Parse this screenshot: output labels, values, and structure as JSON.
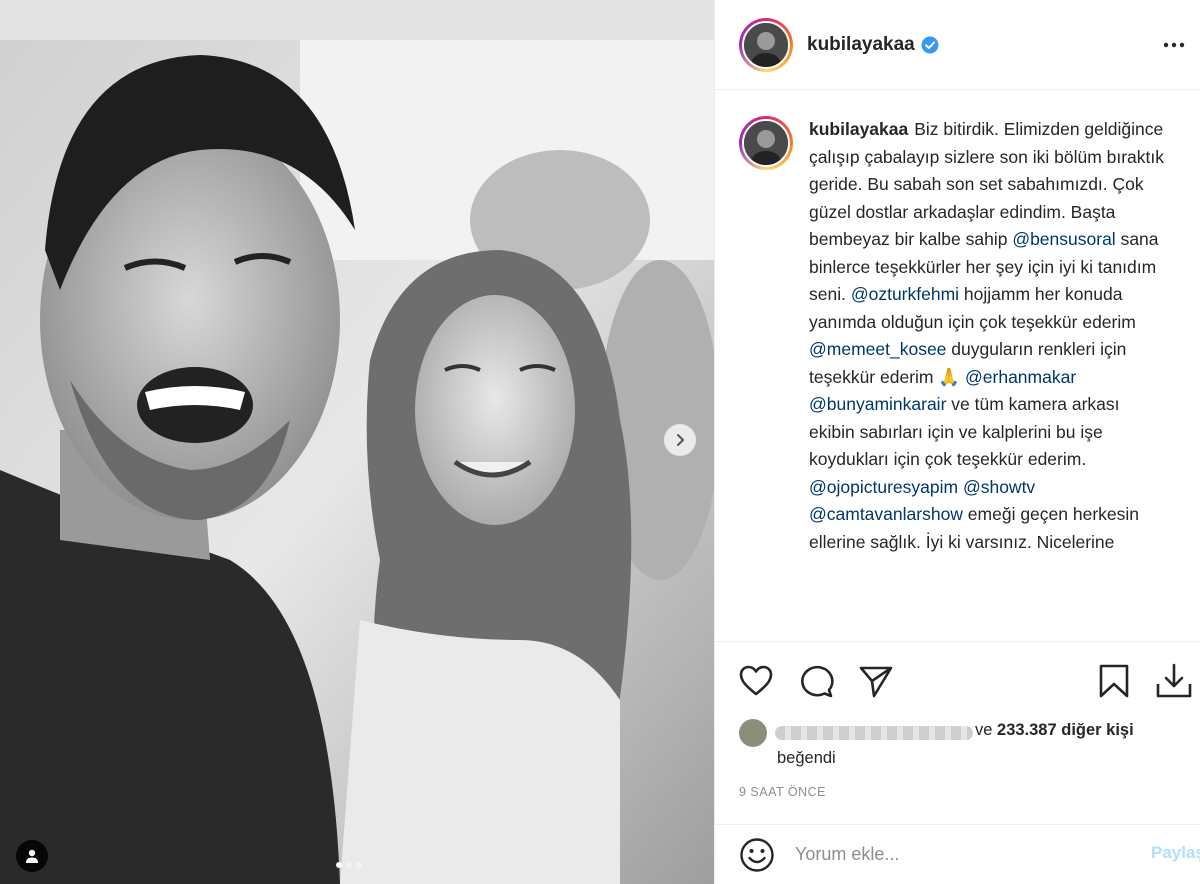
{
  "header": {
    "username": "kubilayakaa",
    "verified": true
  },
  "caption": {
    "username": "kubilayakaa",
    "segments": [
      {
        "text": "Biz bitirdik. Elimizden geldiğince çalışıp çabalayıp sizlere son iki bölüm bıraktık geride. Bu sabah son set sabahımızdı. Çok güzel dostlar arkadaşlar edindim. Başta bembeyaz bir kalbe sahip ",
        "mention": false
      },
      {
        "text": "@bensusoral",
        "mention": true
      },
      {
        "text": " sana binlerce teşekkürler her şey için iyi ki tanıdım seni. ",
        "mention": false
      },
      {
        "text": "@ozturkfehmi",
        "mention": true
      },
      {
        "text": " hojjamm her konuda yanımda olduğun için çok teşekkür ederim ",
        "mention": false
      },
      {
        "text": "@memeet_kosee",
        "mention": true
      },
      {
        "text": " duyguların renkleri için teşekkür ederim 🙏 ",
        "mention": false
      },
      {
        "text": "@erhanmakar",
        "mention": true
      },
      {
        "text": " ",
        "mention": false
      },
      {
        "text": "@bunyaminkarair",
        "mention": true
      },
      {
        "text": " ve tüm kamera arkası ekibin sabırları için ve kalplerini bu işe koydukları için çok teşekkür ederim. ",
        "mention": false
      },
      {
        "text": "@ojopicturesyapim",
        "mention": true
      },
      {
        "text": " ",
        "mention": false
      },
      {
        "text": "@showtv",
        "mention": true
      },
      {
        "text": " ",
        "mention": false
      },
      {
        "text": "@camtavanlarshow",
        "mention": true
      },
      {
        "text": " emeği geçen herkesin ellerine sağlık. İyi ki varsınız. Nicelerine",
        "mention": false
      }
    ]
  },
  "likes": {
    "prefix": "ve ",
    "count": "233.387 diğer kişi",
    "liked_text": "beğendi"
  },
  "time_ago": "9 SAAT ÖNCE",
  "comment": {
    "placeholder": "Yorum ekle...",
    "post_label": "Paylaş"
  },
  "carousel": {
    "total": 3,
    "active_index": 0
  },
  "icons": {
    "more": "more-options-icon",
    "like": "heart-icon",
    "comment": "comment-bubble-icon",
    "share": "paper-plane-icon",
    "save": "bookmark-icon",
    "download": "download-icon",
    "emoji": "emoji-icon",
    "next": "chevron-right-icon",
    "tag": "user-tag-icon",
    "verified": "verified-badge-icon"
  },
  "colors": {
    "verified": "#3897f0",
    "mention": "#00376b",
    "post_button_disabled": "#b2dffc",
    "muted": "#8e8e8e"
  }
}
